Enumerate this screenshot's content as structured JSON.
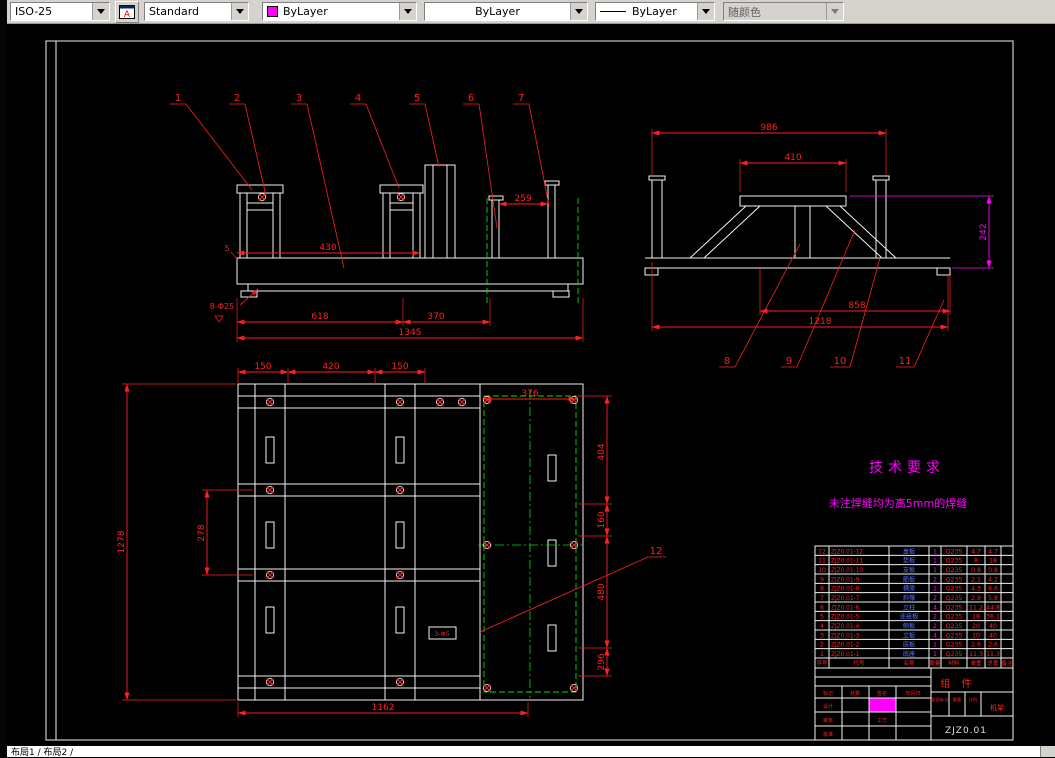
{
  "toolbar": {
    "dim_style": "ISO-25",
    "text_style": "Standard",
    "color": "ByLayer",
    "color_swatch": "#ff00ff",
    "linetype": "ByLayer",
    "lineweight": "ByLayer",
    "plot_style": "随颜色"
  },
  "statusbar": {
    "layout_tabs": "布局1 ∕ 布局2 ∕"
  },
  "drawing": {
    "tech_req": {
      "title": "技术要求",
      "note": "未注焊缝均为高5mm的焊缝"
    },
    "callouts": {
      "n1": "1",
      "n2": "2",
      "n3": "3",
      "n4": "4",
      "n5": "5",
      "n6": "6",
      "n7": "7",
      "n8": "8",
      "n9": "9",
      "n10": "10",
      "n11": "11",
      "n12": "12"
    },
    "front_dims": {
      "w259": "259",
      "t5": "5",
      "w430": "430",
      "holes": "8-Φ25",
      "w618": "618",
      "w370": "370",
      "w1345": "1345"
    },
    "side_dims": {
      "w986": "986",
      "w410": "410",
      "h242": "242",
      "w858": "858",
      "w1218": "1218"
    },
    "plan_dims": {
      "w150a": "150",
      "w420": "420",
      "w150b": "150",
      "w376": "376",
      "h1278": "1278",
      "h278": "278",
      "h404": "404",
      "h160": "160",
      "h480": "480",
      "h296": "296",
      "w1162": "1162",
      "detail": "3-Φ5"
    },
    "bom": {
      "headers": [
        "序号",
        "代号",
        "名称",
        "数量",
        "材料",
        "单重",
        "总重",
        "备注"
      ],
      "rows": [
        [
          "12",
          "ZJZ0.01-12",
          "盖板",
          "1",
          "Q235",
          "4.7",
          "4.7"
        ],
        [
          "11",
          "ZJZ0.01-11",
          "垫板",
          "1",
          "Q235",
          "8",
          "18"
        ],
        [
          "10",
          "ZJZ0.01-10",
          "支板",
          "1",
          "Q235",
          "0.8",
          "0.8"
        ],
        [
          "9",
          "ZJZ0.01-9",
          "筋板",
          "2",
          "Q235",
          "2.1",
          "4.2"
        ],
        [
          "8",
          "ZJZ0.01-8",
          "横梁",
          "2",
          "Q235",
          "4.3",
          "8.6"
        ],
        [
          "7",
          "ZJZ0.01-7",
          "斜撑",
          "2",
          "Q235",
          "2.9",
          "5.8"
        ],
        [
          "6",
          "ZJZ0.01-6",
          "立柱",
          "4",
          "Q235",
          "11.2",
          "44.8"
        ],
        [
          "5",
          "ZJZ0.01-5",
          "连接板",
          "2",
          "Q235",
          "18",
          "36.1"
        ],
        [
          "4",
          "ZJZ0.01-4",
          "侧板",
          "2",
          "Q235",
          "20",
          "40"
        ],
        [
          "3",
          "ZJZ0.01-3",
          "立板",
          "4",
          "Q235",
          "10",
          "40"
        ],
        [
          "2",
          "ZJZ0.01-2",
          "底板",
          "1",
          "Q235",
          "2.6",
          "2.6"
        ],
        [
          "1",
          "ZJZ0.01-1",
          "底座",
          "1",
          "Q235",
          "11.3",
          "11.3"
        ]
      ]
    },
    "title_block": {
      "part_type": "组  件",
      "product": "机架",
      "drawing_no": "ZJZ0.01",
      "labels": {
        "mark": "标记",
        "count": "处数",
        "sign": "签名",
        "date": "年月日",
        "design": "设计",
        "review": "审核",
        "approve": "批准",
        "process": "工艺",
        "stage": "阶段标记",
        "weight": "重量",
        "scale": "比例"
      }
    }
  }
}
